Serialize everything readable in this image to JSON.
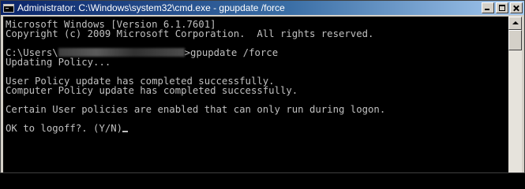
{
  "window": {
    "title": "Administrator: C:\\Windows\\system32\\cmd.exe - gpupdate  /force"
  },
  "console": {
    "lines": [
      "Microsoft Windows [Version 6.1.7601]",
      "Copyright (c) 2009 Microsoft Corporation.  All rights reserved.",
      "",
      "C:\\Users\\",
      "Updating Policy...",
      "",
      "User Policy update has completed successfully.",
      "Computer Policy update has completed successfully.",
      "",
      "Certain User policies are enabled that can only run during logon.",
      "",
      "OK to logoff?. (Y/N)"
    ],
    "prompt_command": ">gpupdate /force"
  },
  "icons": {
    "app": "cmd-icon",
    "minimize": "minimize-icon",
    "maximize": "maximize-icon",
    "close": "close-icon",
    "scroll_up": "scroll-up-arrow-icon"
  }
}
